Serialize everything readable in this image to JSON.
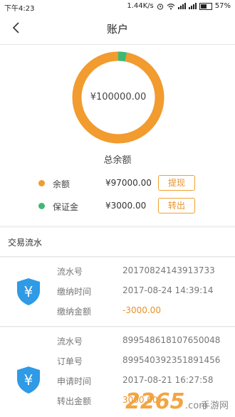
{
  "status_bar": {
    "time": "下午4:23",
    "network_speed": "1.44K/s",
    "battery": "57%"
  },
  "nav": {
    "title": "账户",
    "back_icon": "chevron-left-icon"
  },
  "summary": {
    "total_amount": "¥100000.00",
    "total_label": "总余额",
    "ring_segments": [
      {
        "name": "余额",
        "value": 97000,
        "color": "#f29b2e"
      },
      {
        "name": "保证金",
        "value": 3000,
        "color": "#3fb874"
      }
    ],
    "items": [
      {
        "label": "余额",
        "value": "¥97000.00",
        "button": "提现",
        "color": "#f29b2e"
      },
      {
        "label": "保证金",
        "value": "¥3000.00",
        "button": "转出",
        "color": "#3fb874"
      }
    ]
  },
  "transactions": {
    "title": "交易流水",
    "records": [
      {
        "icon": "yen-shield-icon",
        "fields": [
          {
            "key": "流水号",
            "value": "20170824143913733"
          },
          {
            "key": "缴纳时间",
            "value": "2017-08-24 14:39:14"
          },
          {
            "key": "缴纳金额",
            "value": "-3000.00",
            "highlight": true
          }
        ]
      },
      {
        "icon": "yen-shield-icon",
        "fields": [
          {
            "key": "流水号",
            "value": "899548618107650048"
          },
          {
            "key": "订单号",
            "value": "899540392351891456"
          },
          {
            "key": "申请时间",
            "value": "2017-08-21 16:27:58"
          },
          {
            "key": "转出金额",
            "value": "3000.00",
            "highlight": true
          }
        ]
      }
    ]
  },
  "watermark": {
    "number": "2265",
    "suffix": ".com",
    "cn": "手游网"
  }
}
